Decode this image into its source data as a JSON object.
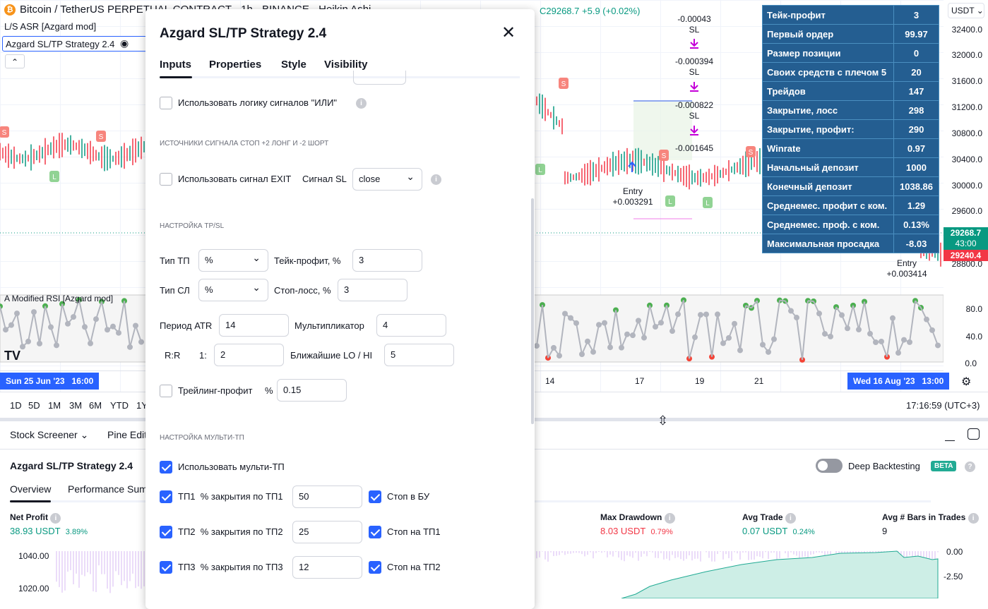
{
  "header": {
    "symbol": "Bitcoin / TetherUS PERPETUAL CONTRACT · 1h · BINANCE · Heikin Ashi",
    "close": "C29268.7",
    "change": "+5.9 (+0.02%)",
    "currency": "USDT"
  },
  "indicators": {
    "asr": "L/S ASR [Azgard mod]",
    "strategy": "Azgard SL/TP Strategy 2.4",
    "rsi": "A Modified RSI [Azgard mod]"
  },
  "price_axis": [
    "32400.0",
    "32000.0",
    "31600.0",
    "31200.0",
    "30800.0",
    "30400.0",
    "30000.0",
    "29600.0",
    "28800.0"
  ],
  "price_tags": {
    "last": "29268.7",
    "countdown": "43:00",
    "low": "29240.4"
  },
  "rsi_axis": [
    "80.0",
    "40.0",
    "0.0"
  ],
  "annotations": {
    "sl1": "-0.00043",
    "sl2": "-0.000394",
    "sl3": "-0.000822",
    "sl4": "-0.001645",
    "sl": "SL",
    "entry1": "Entry",
    "entry1_val": "+0.003291",
    "entry2": "Entry",
    "entry2_val": "+0.003414",
    "s": "S",
    "l": "L"
  },
  "stats_table": [
    [
      "Тейк-профит",
      "3"
    ],
    [
      "Первый ордер",
      "99.97"
    ],
    [
      "Размер позиции",
      "0"
    ],
    [
      "Своих средств с плечом 5",
      "20"
    ],
    [
      "Трейдов",
      "147"
    ],
    [
      "Закрытие, лосс",
      "298"
    ],
    [
      "Закрытие, профит:",
      "290"
    ],
    [
      "Winrate",
      "0.97"
    ],
    [
      "Начальный депозит",
      "1000"
    ],
    [
      "Конечный депозит",
      "1038.86"
    ],
    [
      "Среднемес. профит с ком.",
      "1.29"
    ],
    [
      "Среднемес. проф. с ком.",
      "0.13%"
    ],
    [
      "Максимальная просадка",
      "-8.03"
    ]
  ],
  "time_axis": {
    "ticks": [
      "14",
      "17",
      "19",
      "21"
    ],
    "cursor_start": "Sun 25 Jun '23   16:00",
    "cursor_end": "Wed 16 Aug '23   13:00"
  },
  "ranges": [
    "1D",
    "5D",
    "1M",
    "3M",
    "6M",
    "YTD",
    "1Y"
  ],
  "clock": "17:16:59 (UTC+3)",
  "bottom": {
    "tabs": [
      "Stock Screener",
      "Pine Edit"
    ],
    "strategy_title": "Azgard SL/TP Strategy 2.4",
    "deep_backtesting": "Deep Backtesting",
    "deep_backtesting_on": false,
    "beta": "BETA",
    "subtabs": [
      "Overview",
      "Performance Sum"
    ],
    "metrics": [
      {
        "label": "Net Profit",
        "value": "38.93 USDT",
        "pct": "3.89%"
      },
      {
        "label": "Max Drawdown",
        "value": "8.03 USDT",
        "pct": "0.79%"
      },
      {
        "label": "Avg Trade",
        "value": "0.07 USDT",
        "pct": "0.24%"
      },
      {
        "label": "Avg # Bars in Trades",
        "value": "9"
      }
    ],
    "left_axis": [
      "1040.00",
      "1020.00"
    ],
    "right_axis": [
      "0.00",
      "-2.50"
    ]
  },
  "dialog": {
    "title": "Azgard SL/TP Strategy 2.4",
    "tabs": [
      "Inputs",
      "Properties",
      "Style",
      "Visibility"
    ],
    "or_logic": {
      "label": "Использовать логику сигналов \"ИЛИ\"",
      "checked": false
    },
    "sec_stop": "ИСТОЧНИКИ СИГНАЛА СТОП +2 ЛОНГ И -2 ШОРТ",
    "exit_signal": {
      "label": "Использовать сигнал EXIT",
      "checked": false,
      "sl_label": "Сигнал SL",
      "sl_value": "close"
    },
    "sec_tpsl": "НАСТРОЙКА TP/SL",
    "tp_type": {
      "label": "Тип ТП",
      "value": "%"
    },
    "tp": {
      "label": "Тейк-профит, %",
      "value": "3"
    },
    "sl_type": {
      "label": "Тип СЛ",
      "value": "%"
    },
    "sl": {
      "label": "Стоп-лосс, %",
      "value": "3"
    },
    "atr": {
      "label": "Период ATR",
      "value": "14"
    },
    "mult": {
      "label": "Мультипликатор",
      "value": "4"
    },
    "rr": {
      "label": "R:R",
      "prefix": "1:",
      "value": "2"
    },
    "lohi": {
      "label": "Ближайшие LO / HI",
      "value": "5"
    },
    "trailing": {
      "label": "Трейлинг-профит",
      "unit": "%",
      "value": "0.15",
      "checked": false
    },
    "sec_multi": "НАСТРОЙКА МУЛЬТИ-ТП",
    "multi": {
      "label": "Использовать мульти-ТП",
      "checked": true
    },
    "tp_rows": [
      {
        "label": "ТП1  % закрытия по ТП1",
        "value": "50",
        "stop": "Стоп в БУ"
      },
      {
        "label": "ТП2  % закрытия по ТП2",
        "value": "25",
        "stop": "Стоп на ТП1"
      },
      {
        "label": "ТП3  % закрытия по ТП3",
        "value": "12",
        "stop": "Стоп на ТП2"
      }
    ]
  }
}
